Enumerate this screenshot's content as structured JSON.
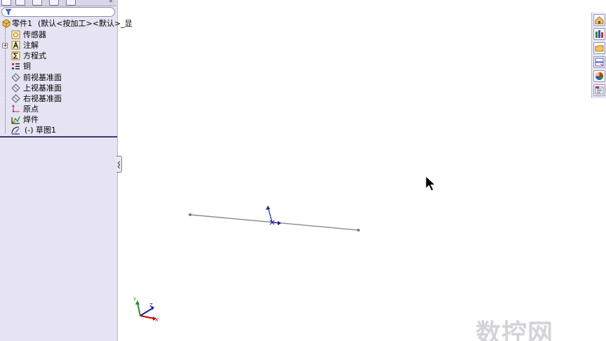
{
  "feature_tree": {
    "root": {
      "label": "零件1",
      "config": "(默认<按加工><默认>_显"
    },
    "items": [
      {
        "label": "传感器",
        "icon": "sensor-icon"
      },
      {
        "label": "注解",
        "icon": "annotation-icon",
        "expandable": true
      },
      {
        "label": "方程式",
        "icon": "equation-icon"
      },
      {
        "label": "铜",
        "icon": "material-icon"
      },
      {
        "label": "前视基准面",
        "icon": "plane-icon"
      },
      {
        "label": "上视基准面",
        "icon": "plane-icon"
      },
      {
        "label": "右视基准面",
        "icon": "plane-icon"
      },
      {
        "label": "原点",
        "icon": "origin-icon"
      },
      {
        "label": "焊件",
        "icon": "weldment-icon"
      },
      {
        "label": "(-)  草图1",
        "icon": "sketch-icon"
      }
    ]
  },
  "triad": {
    "x": "X",
    "y": "Y",
    "z": "Z"
  },
  "watermark": "数控网",
  "colors": {
    "panel_bg": "#e6e3f3",
    "sketch_line": "#8a8a8a",
    "triad_x": "#cc0000",
    "triad_y": "#2a8a2a",
    "triad_z": "#1a1aa0",
    "sketch_origin": "#1a1aa0"
  },
  "view_toolbar": [
    "home-icon",
    "resources-icon",
    "file-explorer-icon",
    "view-palette-icon",
    "appearance-icon",
    "custom-properties-icon"
  ]
}
